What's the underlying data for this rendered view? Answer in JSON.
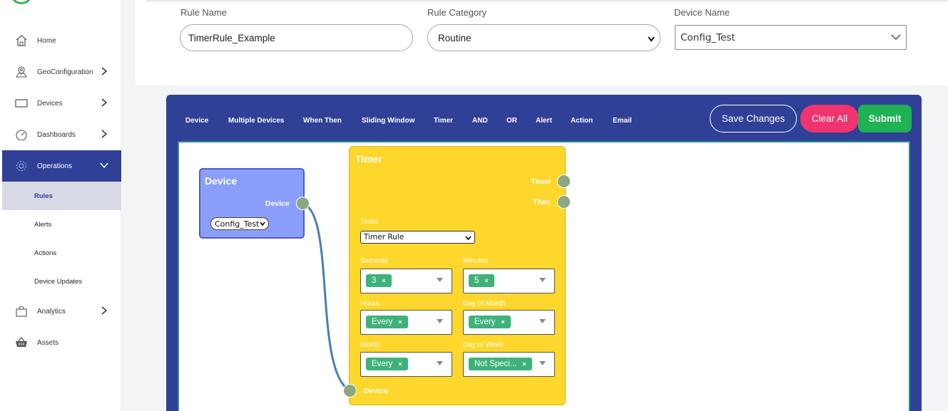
{
  "sidebar": {
    "items": [
      {
        "label": "Home",
        "icon": "home-icon"
      },
      {
        "label": "GeoConfiguration",
        "icon": "map-pin-icon"
      },
      {
        "label": "Devices",
        "icon": "monitor-icon"
      },
      {
        "label": "Dashboards",
        "icon": "gauge-icon"
      },
      {
        "label": "Operations",
        "icon": "gear-icon"
      },
      {
        "label": "Analytics",
        "icon": "shopping-bag-icon"
      },
      {
        "label": "Assets",
        "icon": "basket-icon"
      }
    ],
    "operations_sub": [
      {
        "label": "Rules"
      },
      {
        "label": "Alerts"
      },
      {
        "label": "Actions"
      },
      {
        "label": "Device Updates"
      }
    ]
  },
  "form": {
    "rule_name_label": "Rule Name",
    "rule_name_value": "TimerRule_Example",
    "rule_category_label": "Rule Category",
    "rule_category_value": "Routine",
    "device_name_label": "Device Name",
    "device_name_value": "Config_Test"
  },
  "toolbar": {
    "items": [
      "Device",
      "Multiple Devices",
      "When Then",
      "Sliding Window",
      "Timer",
      "AND",
      "OR",
      "Alert",
      "Action",
      "Email"
    ],
    "save_label": "Save Changes",
    "clear_label": "Clear All",
    "submit_label": "Submit"
  },
  "device_node": {
    "title": "Device",
    "output_port_label": "Device",
    "device_select_value": "Config_Test"
  },
  "timer_node": {
    "title": "Timer",
    "output_ports": [
      "Timer",
      "Then"
    ],
    "input_port_label": "Device",
    "timer_label": "Timer",
    "timer_select_value": "Timer Rule",
    "fields": [
      {
        "label": "Seconds",
        "chip": "3"
      },
      {
        "label": "Minutes",
        "chip": "5"
      },
      {
        "label": "Hours",
        "chip": "Every"
      },
      {
        "label": "Day of Month",
        "chip": "Every"
      },
      {
        "label": "Month",
        "chip": "Every"
      },
      {
        "label": "Day of Week",
        "chip": "Not Speci..."
      }
    ]
  },
  "colors": {
    "primary": "#2f4096",
    "clear": "#f0346f",
    "submit": "#1eb254",
    "timer_node": "#fdd72b",
    "device_node": "#8c9efc",
    "chip": "#3eb27a",
    "connector": "#4a7fb0"
  }
}
